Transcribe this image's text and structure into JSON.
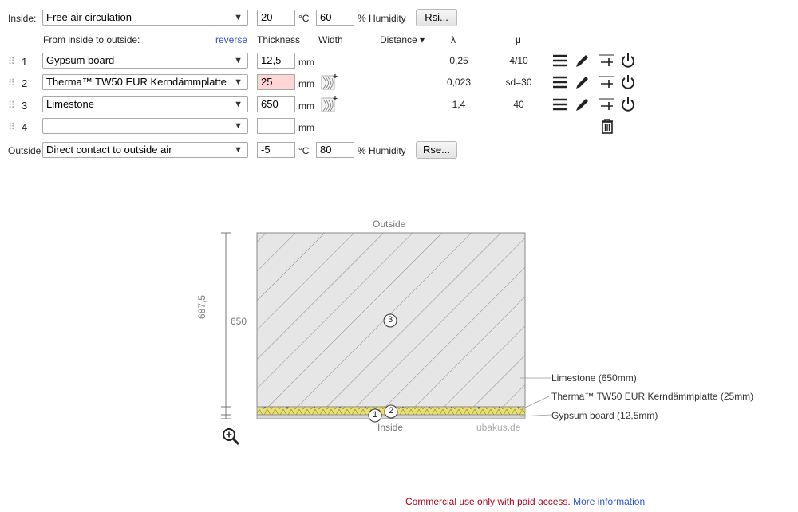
{
  "inside": {
    "label": "Inside:",
    "condition": "Free air circulation",
    "temperature": "20",
    "temp_unit": "°C",
    "humidity": "60",
    "humidity_label": "% Humidity",
    "resistance_button": "Rsi..."
  },
  "headers": {
    "direction": "From inside to outside:",
    "reverse": "reverse",
    "thickness": "Thickness",
    "width": "Width",
    "distance": "Distance ▾",
    "lambda": "λ",
    "mu": "μ"
  },
  "layers": [
    {
      "num": "1",
      "material": "Gypsum board",
      "thickness": "12,5",
      "unit": "mm",
      "lambda": "0,25",
      "mu": "4/10"
    },
    {
      "num": "2",
      "material": "Therma™ TW50 EUR Kerndämmplatte",
      "thickness": "25",
      "unit": "mm",
      "lambda": "0,023",
      "mu": "sd=30"
    },
    {
      "num": "3",
      "material": "Limestone",
      "thickness": "650",
      "unit": "mm",
      "lambda": "1,4",
      "mu": "40"
    },
    {
      "num": "4",
      "material": "",
      "thickness": "",
      "unit": "mm",
      "lambda": "",
      "mu": ""
    }
  ],
  "outside": {
    "label": "Outside",
    "condition": "Direct contact to outside air",
    "temperature": "-5",
    "temp_unit": "°C",
    "humidity": "80",
    "humidity_label": "% Humidity",
    "resistance_button": "Rse..."
  },
  "drawing": {
    "top_label": "Outside",
    "bottom_label": "Inside",
    "watermark": "ubakus.de",
    "total_dim": "687,5",
    "layer3_dim": "650",
    "marker_1": "1",
    "marker_2": "2",
    "marker_3": "3",
    "legend": [
      "Limestone (650mm)",
      "Therma™ TW50 EUR Kerndämmplatte (25mm)",
      "Gypsum board (12,5mm)"
    ]
  },
  "footer": {
    "notice": "Commercial use only with paid access.",
    "link": "More information"
  }
}
